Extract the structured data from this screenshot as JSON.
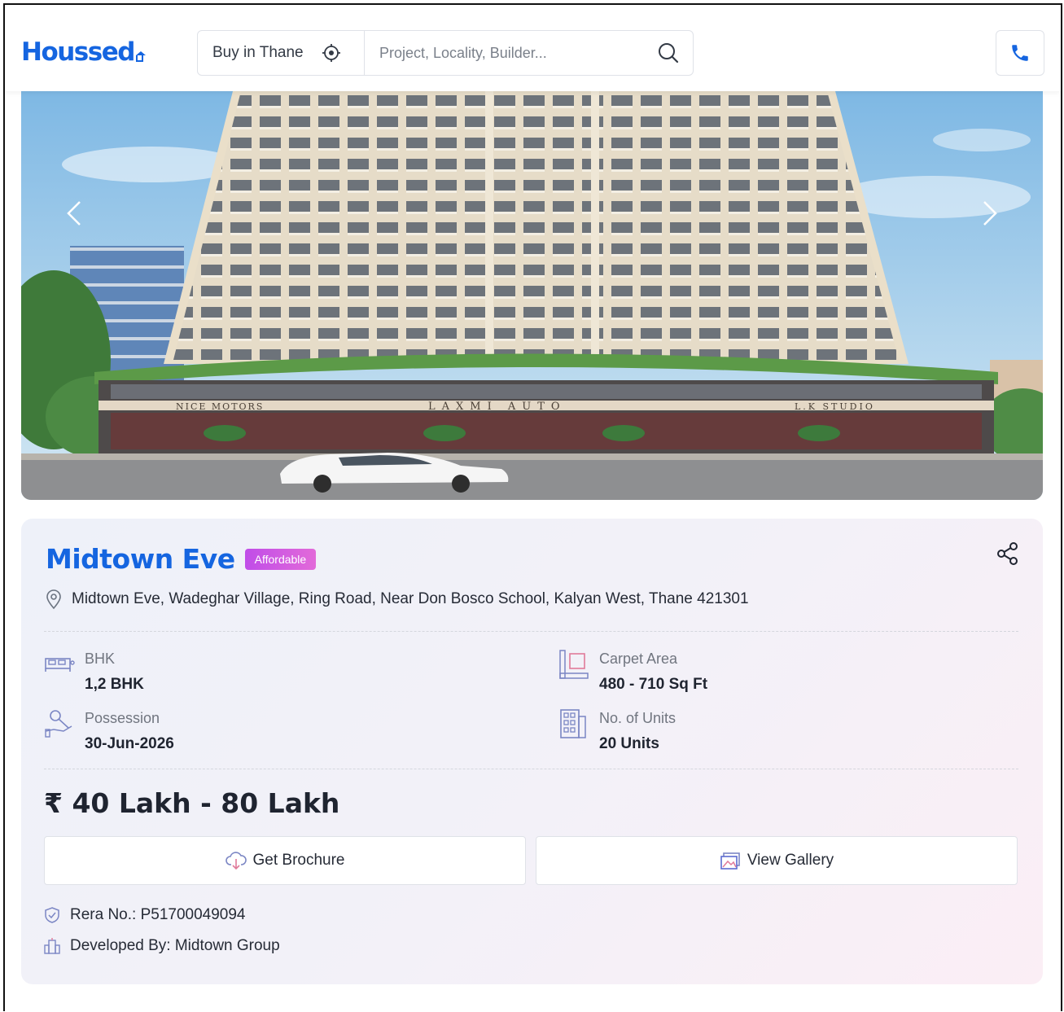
{
  "header": {
    "logo_text": "Houssed",
    "city_selector": "Buy in Thane",
    "search_placeholder": "Project, Locality, Builder..."
  },
  "hero": {
    "signage": [
      "NICE MOTORS",
      "LAXMI AUTO",
      "L.K STUDIO"
    ]
  },
  "project": {
    "title": "Midtown Eve",
    "badge": "Affordable",
    "address": "Midtown Eve, Wadeghar Village, Ring Road, Near Don Bosco School, Kalyan West, Thane 421301",
    "specs": {
      "bhk_label": "BHK",
      "bhk_value": "1,2 BHK",
      "carpet_label": "Carpet Area",
      "carpet_value": "480 - 710 Sq Ft",
      "possession_label": "Possession",
      "possession_value": "30-Jun-2026",
      "units_label": "No. of Units",
      "units_value": "20 Units"
    },
    "price": "₹ 40 Lakh - 80 Lakh",
    "buttons": {
      "brochure": "Get Brochure",
      "gallery": "View Gallery"
    },
    "rera": "Rera No.: P51700049094",
    "developer": "Developed By: Midtown Group"
  },
  "colors": {
    "brand": "#1565e0",
    "badge": "#c04de8",
    "text": "#1f2430"
  }
}
